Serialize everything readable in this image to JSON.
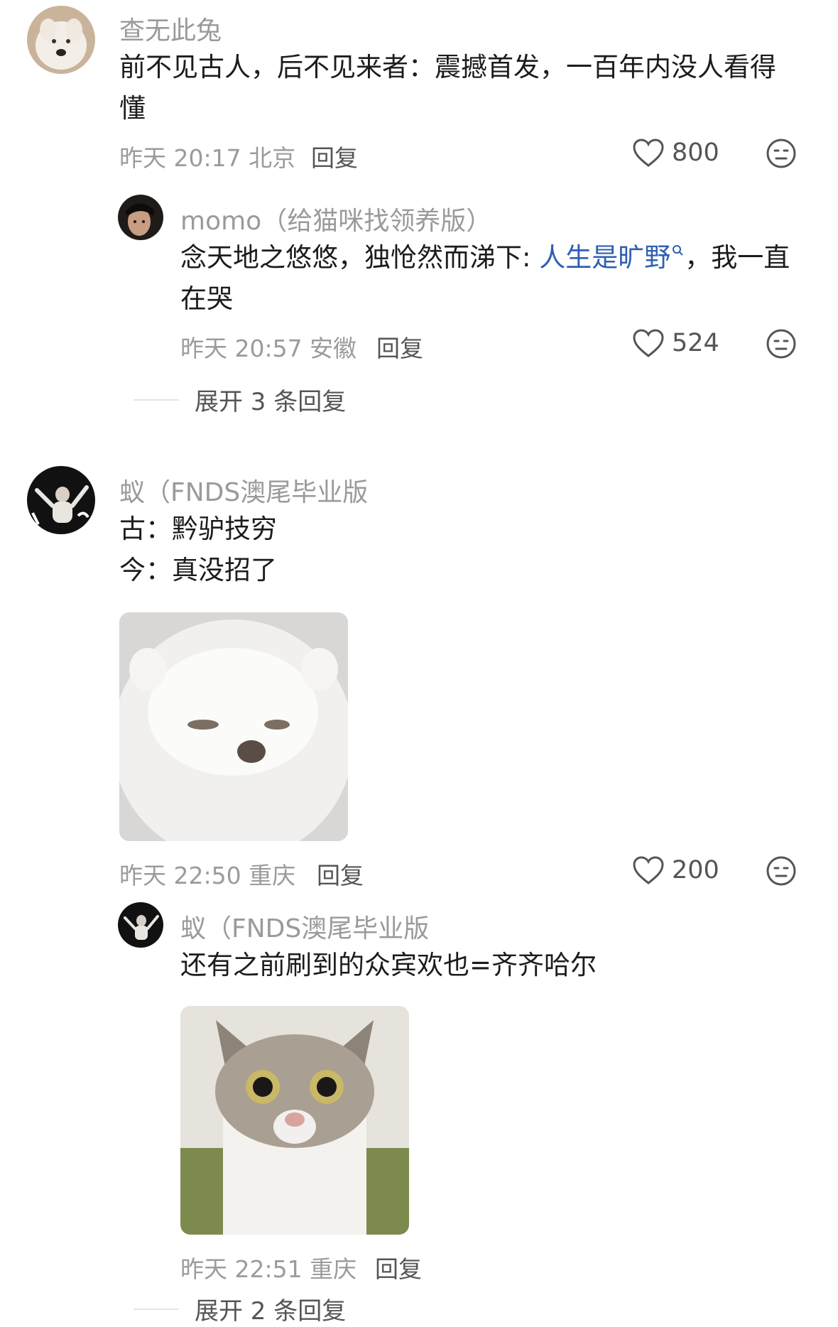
{
  "comments": [
    {
      "username": "查无此兔",
      "text_line1": "前不见古人，后不见来者：震撼首发，一百年内没人看得",
      "text_line2": "懂",
      "time": "昨天 20:17 北京",
      "reply": "回复",
      "likes": "800",
      "sub": {
        "username": "momo（给猫咪找领养版）",
        "text_pre": "念天地之悠悠，独怆然而涕下: ",
        "text_link": "人生是旷野",
        "text_post": "，我一直",
        "text_line2": "在哭",
        "time": "昨天 20:57 安徽",
        "reply": "回复",
        "likes": "524"
      },
      "expand": "展开 3 条回复"
    },
    {
      "username": "蚁（FNDS澳尾毕业版",
      "text_line1": "古：黔驴技穷",
      "text_line2": "今：真没招了",
      "time": "昨天 22:50 重庆",
      "reply": "回复",
      "likes": "200",
      "sub": {
        "username": "蚁（FNDS澳尾毕业版",
        "text": "还有之前刷到的众宾欢也=齐齐哈尔",
        "time": "昨天 22:51 重庆",
        "reply": "回复"
      },
      "expand": "展开 2 条回复"
    }
  ],
  "icons": {
    "like": "heart-outline-icon",
    "dislike": "meh-face-icon",
    "search_link": "search-icon"
  },
  "colors": {
    "link": "#2f5fb2",
    "meta": "#9b9b9b",
    "text": "#1c1c1c"
  }
}
